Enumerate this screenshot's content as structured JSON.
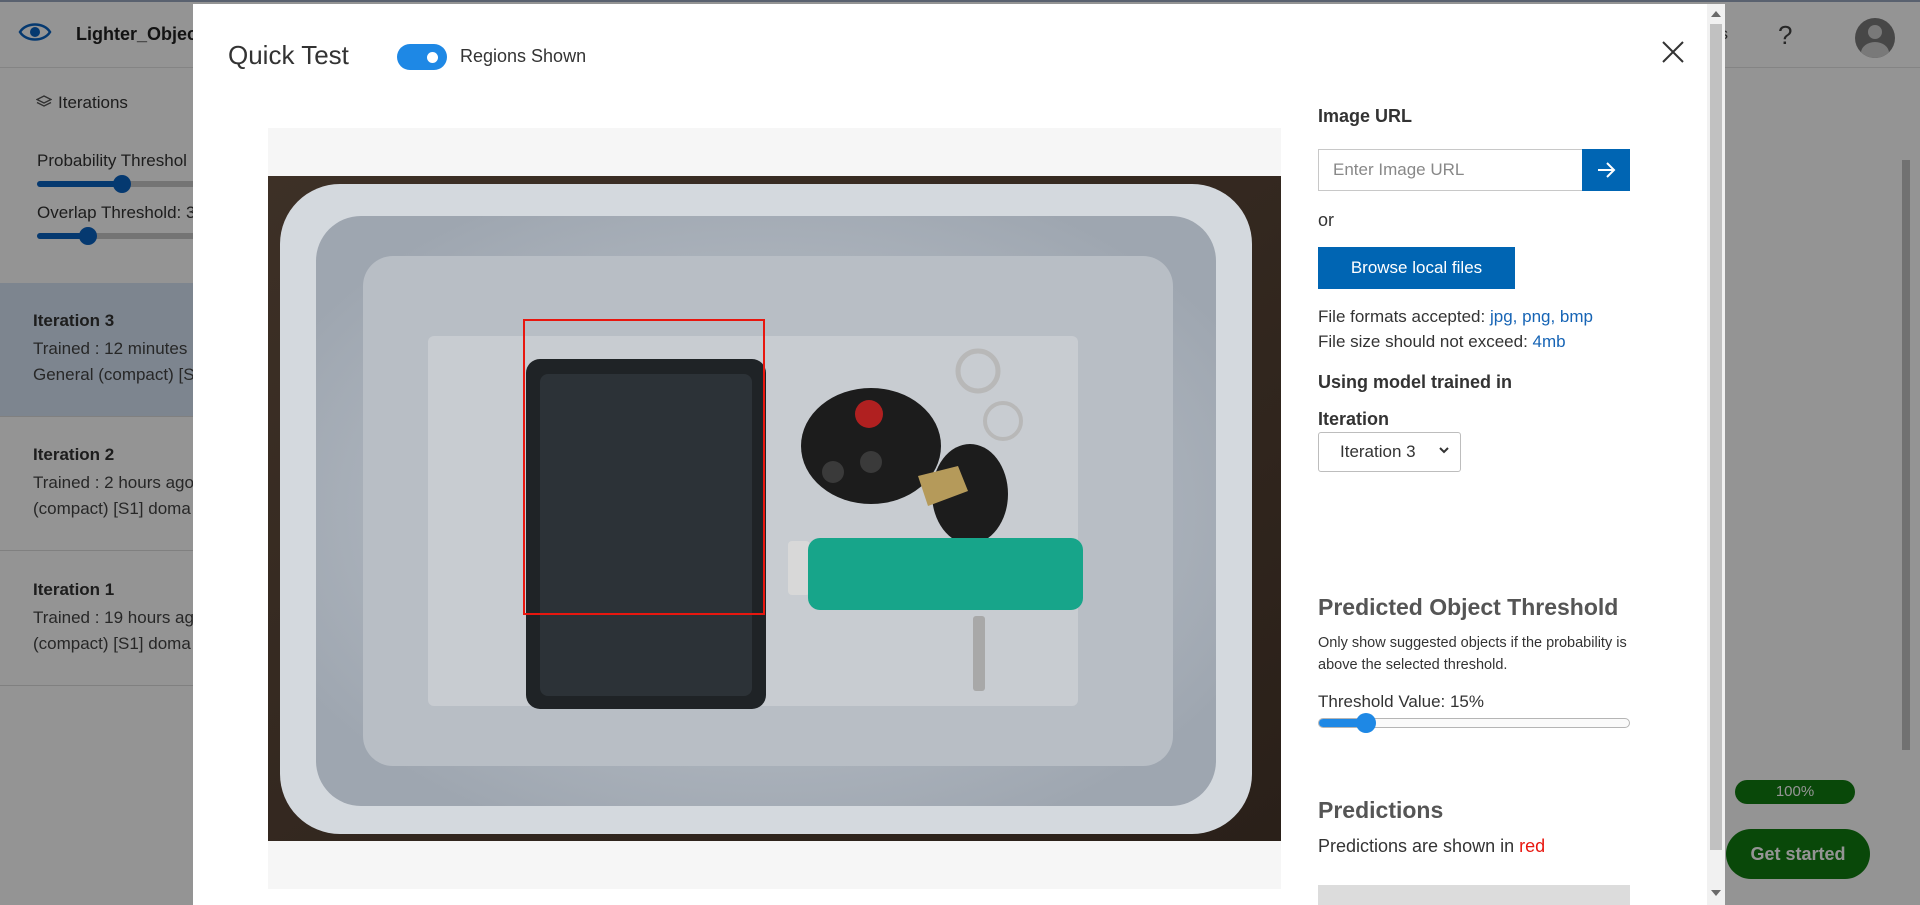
{
  "app": {
    "project_name": "Lighter_Object",
    "header_partial_text": "s",
    "help_label": "?"
  },
  "sidebar": {
    "iterations_heading": "Iterations",
    "probability_label": "Probability Threshol",
    "overlap_label": "Overlap Threshold: 3",
    "probability_value_percent": 50,
    "overlap_value_percent": 30,
    "iterations": [
      {
        "name": "Iteration 3",
        "line1": "Trained : 12 minutes",
        "line2": "General (compact) [S",
        "selected": true
      },
      {
        "name": "Iteration 2",
        "line1": "Trained : 2 hours ago",
        "line2": "(compact) [S1] doma",
        "selected": false
      },
      {
        "name": "Iteration 1",
        "line1": "Trained : 19 hours ag",
        "line2": "(compact) [S1] doma",
        "selected": false
      }
    ]
  },
  "status": {
    "progress_label": "100%",
    "get_started_label": "Get started"
  },
  "modal": {
    "title": "Quick Test",
    "toggle_label": "Regions Shown",
    "toggle_on": true,
    "image_url_label": "Image URL",
    "image_url_placeholder": "Enter Image URL",
    "image_url_value": "",
    "or_label": "or",
    "browse_label": "Browse local files",
    "formats_label": "File formats accepted:",
    "formats_value": "jpg, png, bmp",
    "size_label": "File size should not exceed:",
    "size_value": "4mb",
    "model_label": "Using model trained in",
    "iteration_label": "Iteration",
    "iteration_selected": "Iteration 3",
    "threshold_title": "Predicted Object Threshold",
    "threshold_note": "Only show suggested objects if the probability is above the selected threshold.",
    "threshold_value_label": "Threshold Value: 15%",
    "threshold_value": 15,
    "predictions_title": "Predictions",
    "predictions_note_prefix": "Predictions are shown in",
    "predictions_note_color": "red"
  },
  "colors": {
    "accent": "#1e88e5",
    "primary_button": "#0065b3",
    "prediction_box": "#e8170f",
    "success": "#107c10"
  }
}
